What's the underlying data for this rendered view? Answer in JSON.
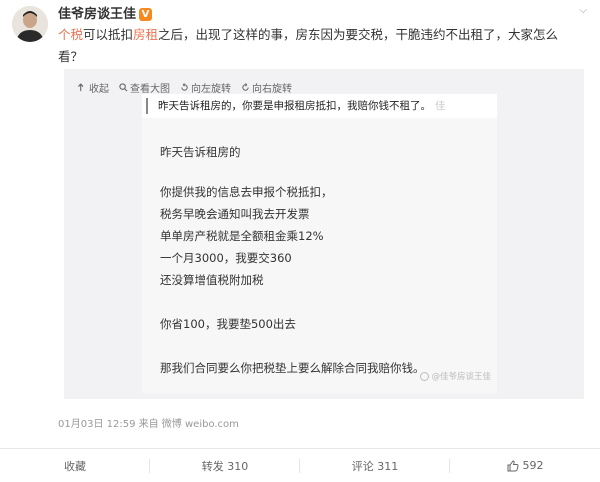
{
  "post": {
    "username": "佳爷房谈王佳",
    "verified_badge": "V",
    "dropdown": "⌵",
    "text": {
      "tag1": "个税",
      "part1": "可以抵扣",
      "tag2": "房租",
      "part2": "之后，出现了这样的事，房东因为要交税，干脆违约不出租了，大家怎么看？"
    },
    "meta": "01月03日 12:59 来自 微博 weibo.com"
  },
  "toolbar": {
    "collapse": "收起",
    "view_large": "查看大图",
    "rotate_left": "向左旋转",
    "rotate_right": "向右旋转"
  },
  "image": {
    "header": "昨天告诉租房的，你要是申报租房抵扣，我赔你钱不租了。",
    "header_fade": "佳",
    "lines": [
      "昨天告诉租房的",
      "",
      "你提供我的信息去申报个税抵扣，",
      "税务早晚会通知叫我去开发票",
      "单单房产税就是全额租金乘12%",
      "一个月3000，我要交360",
      "还没算增值税附加税",
      "",
      "你省100，我要垫500出去",
      "",
      "那我们合同要么你把税垫上要么解除合同我赔你钱。"
    ],
    "watermark": "@佳爷房谈王佳"
  },
  "actions": {
    "favorite": "收藏",
    "repost": "转发 310",
    "comment": "评论 311",
    "like": "592"
  },
  "colors": {
    "tag": "#eb7350",
    "badge": "#f68a21"
  },
  "icons": [
    "avatar",
    "verified-badge-icon",
    "dropdown-arrow-icon",
    "collapse-icon",
    "zoom-icon",
    "rotate-left-icon",
    "rotate-right-icon",
    "watermark-icon",
    "thumb-up-icon"
  ]
}
